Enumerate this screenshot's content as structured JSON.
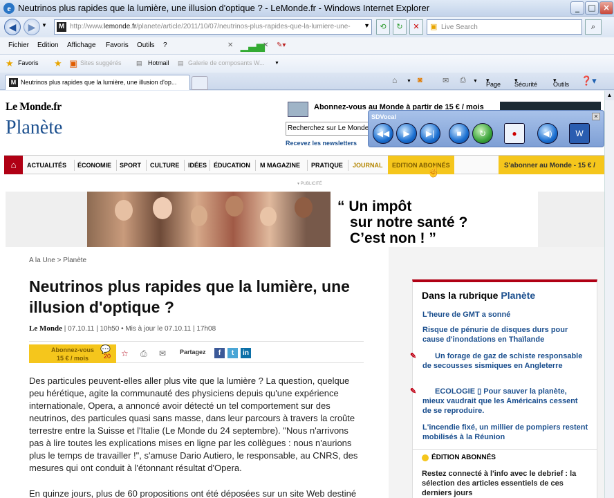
{
  "window": {
    "title": "Neutrinos plus rapides que la lumière, une illusion d'optique ? - LeMonde.fr - Windows Internet Explorer"
  },
  "address": {
    "prefix": "http://www.",
    "domain": "lemonde.fr",
    "path": "/planete/article/2011/10/07/neutrinos-plus-rapides-que-la-lumiere-une-illusi"
  },
  "search": {
    "placeholder": "Live Search"
  },
  "menu": [
    "Fichier",
    "Edition",
    "Affichage",
    "Favoris",
    "Outils",
    "?"
  ],
  "favbar": {
    "favoris": "Favoris",
    "sites": "Sites suggérés",
    "hotmail": "Hotmail",
    "galerie": "Galerie de composants W..."
  },
  "tab": {
    "title": "Neutrinos plus rapides que la lumière, une illusion d'op..."
  },
  "commands": {
    "page": "Page",
    "securite": "Sécurité",
    "outils": "Outils"
  },
  "site": {
    "logo_small": "Le Monde.fr",
    "section": "Planète",
    "promo": "Abonnez-vous au Monde à partir de 15 € / mois",
    "search_value": "Recherchez sur Le Monde",
    "newsletters": "Recevez les newsletters",
    "nav": [
      "ACTUALITÉS",
      "ÉCONOMIE",
      "SPORT",
      "CULTURE",
      "IDÉES",
      "ÉDUCATION",
      "M MAGAZINE",
      "PRATIQUE",
      "JOURNAL",
      "EDITION ABONNÉS"
    ],
    "subscribe": "S'abonner au Monde - 15 € /",
    "pub": "PUBLICITÉ",
    "ad": [
      "“ Un impôt",
      "sur notre santé ?",
      "C’est non ! ”"
    ]
  },
  "article": {
    "breadcrumb": "A la Une > Planète",
    "title": "Neutrinos plus rapides que la lumière, une illusion d'optique ?",
    "source": "Le Monde",
    "meta": "| 07.10.11 | 10h50  •  Mis à jour le 07.10.11 | 17h08",
    "subscribe_btn": [
      "Abonnez-vous",
      "15 € / mois"
    ],
    "comments": "20",
    "share": "Partagez",
    "p1": "Des particules peuvent-elles aller plus vite que la lumière ? La question, quelque peu hérétique, agite la communauté des physiciens depuis qu'une expérience internationale, Opera, a annoncé avoir détecté un tel comportement sur des neutrinos, des particules quasi sans masse, dans leur parcours à travers la croûte terrestre entre la Suisse et l'Italie (Le Monde du 24 septembre). \"Nous n'arrivons pas à lire toutes les explications mises en ligne par les collègues : nous n'aurions plus le temps de travailler !\", s'amuse Dario Autiero, le responsable, au CNRS, des mesures qui ont conduit à l'étonnant résultat d'Opera.",
    "p2": "En quinze jours, plus de 60 propositions ont été déposées sur un site Web destiné"
  },
  "sidebar": {
    "heading": "Dans la rubrique",
    "heading_section": "Planète",
    "links": [
      "L'heure de GMT a sonné",
      "Risque de pénurie de disques durs pour cause d'inondations en Thaïlande",
      "Un forage de gaz de schiste responsable de secousses sismiques en Angleterre",
      "ECOLOGIE ▯ Pour sauver la planète, mieux vaudrait que les Américains cessent de se reproduire.",
      "L'incendie fixé, un millier de pompiers restent mobilisés à la Réunion"
    ],
    "edition": "ÉDITION ABONNÉS",
    "edition_text": "Restez connecté à l'info avec le debrief : la sélection des articles essentiels de ces derniers jours"
  },
  "sdvocal": {
    "title": "SDVocal"
  }
}
